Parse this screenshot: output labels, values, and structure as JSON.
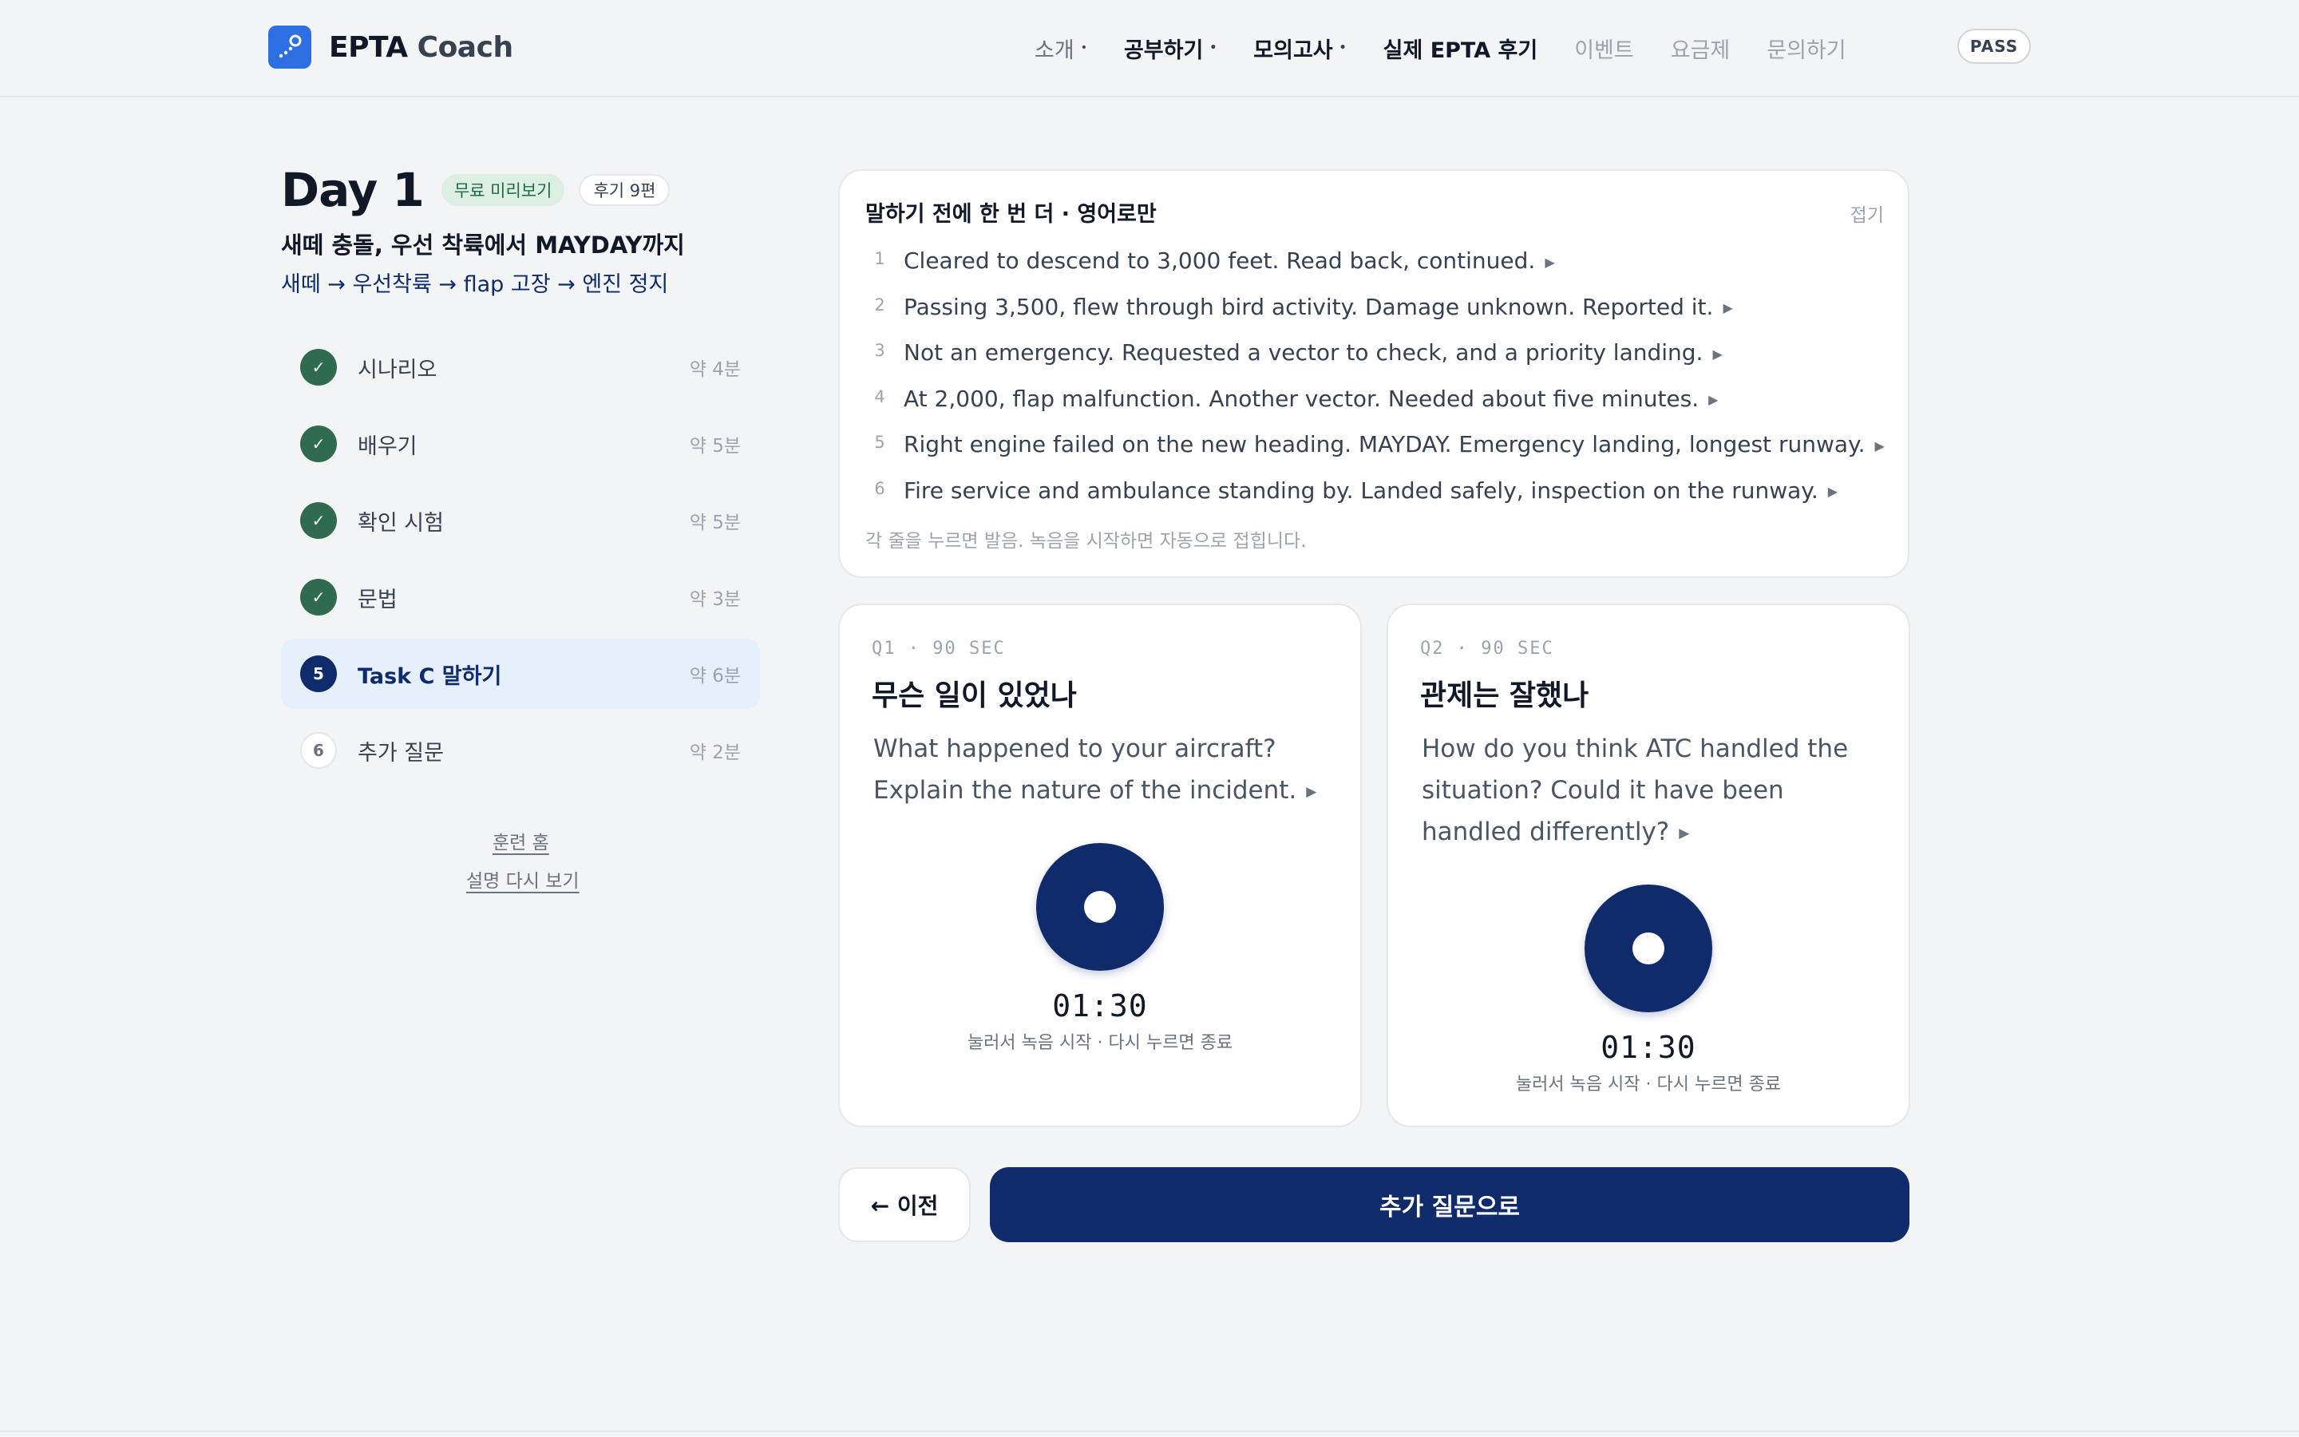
{
  "header": {
    "brand": "EPTA",
    "brand_suffix": "Coach",
    "nav": [
      {
        "label": "소개",
        "caret": "•"
      },
      {
        "label": "공부하기",
        "caret": "•"
      },
      {
        "label": "모의고사",
        "caret": "•"
      },
      {
        "label": "실제 EPTA 후기"
      },
      {
        "label": "이벤트"
      },
      {
        "label": "요금제"
      },
      {
        "label": "문의하기"
      }
    ],
    "pass_label": "PASS"
  },
  "day": {
    "title": "Day 1",
    "badge_free": "무료 미리보기",
    "badge_reviews": "후기 9편",
    "subtitle": "새떼 충돌, 우선 착륙에서 MAYDAY까지",
    "path": "새떼 → 우선착륙 → flap 고장 → 엔진 정지"
  },
  "steps": [
    {
      "marker": "✓",
      "label": "시나리오",
      "time": "약 4분"
    },
    {
      "marker": "✓",
      "label": "배우기",
      "time": "약 5분"
    },
    {
      "marker": "✓",
      "label": "확인 시험",
      "time": "약 5분"
    },
    {
      "marker": "✓",
      "label": "문법",
      "time": "약 3분"
    },
    {
      "marker": "5",
      "label": "Task C 말하기",
      "time": "약 6분"
    },
    {
      "marker": "6",
      "label": "추가 질문",
      "time": "약 2분"
    }
  ],
  "links": {
    "home": "훈련 홈",
    "guide": "설명 다시 보기"
  },
  "reading": {
    "title": "말하기 전에 한 번 더 · 영어로만",
    "fold": "접기",
    "lines": [
      {
        "n": "1",
        "text": "Cleared to descend to 3,000 feet. Read back, continued."
      },
      {
        "n": "2",
        "text": "Passing 3,500, flew through bird activity. Damage unknown. Reported it."
      },
      {
        "n": "3",
        "text": "Not an emergency. Requested a vector to check, and a priority landing."
      },
      {
        "n": "4",
        "text": "At 2,000, flap malfunction. Another vector. Needed about five minutes."
      },
      {
        "n": "5",
        "text": "Right engine failed on the new heading. MAYDAY. Emergency landing, longest runway."
      },
      {
        "n": "6",
        "text": "Fire service and ambulance standing by. Landed safely, inspection on the runway."
      }
    ],
    "hint": "각 줄을 누르면 발음. 녹음을 시작하면 자동으로 접힙니다.",
    "play_icon": "▶"
  },
  "questions": [
    {
      "meta": "Q1 · 90 SEC",
      "title": "무슨 일이 있었나",
      "body": "What happened to your aircraft? Explain the nature of the incident.",
      "timer": "01:30",
      "hint": "눌러서 녹음 시작 · 다시 누르면 종료"
    },
    {
      "meta": "Q2 · 90 SEC",
      "title": "관제는 잘했나",
      "body": "How do you think ATC handled the situation? Could it have been handled differently?",
      "timer": "01:30",
      "hint": "눌러서 녹음 시작 · 다시 누르면 종료"
    }
  ],
  "buttons": {
    "prev": "← 이전",
    "next": "추가 질문으로"
  },
  "colors": {
    "navy": "#0f2b6b",
    "done_green": "#2f6b4f",
    "brand_blue": "#2f6fe4"
  }
}
